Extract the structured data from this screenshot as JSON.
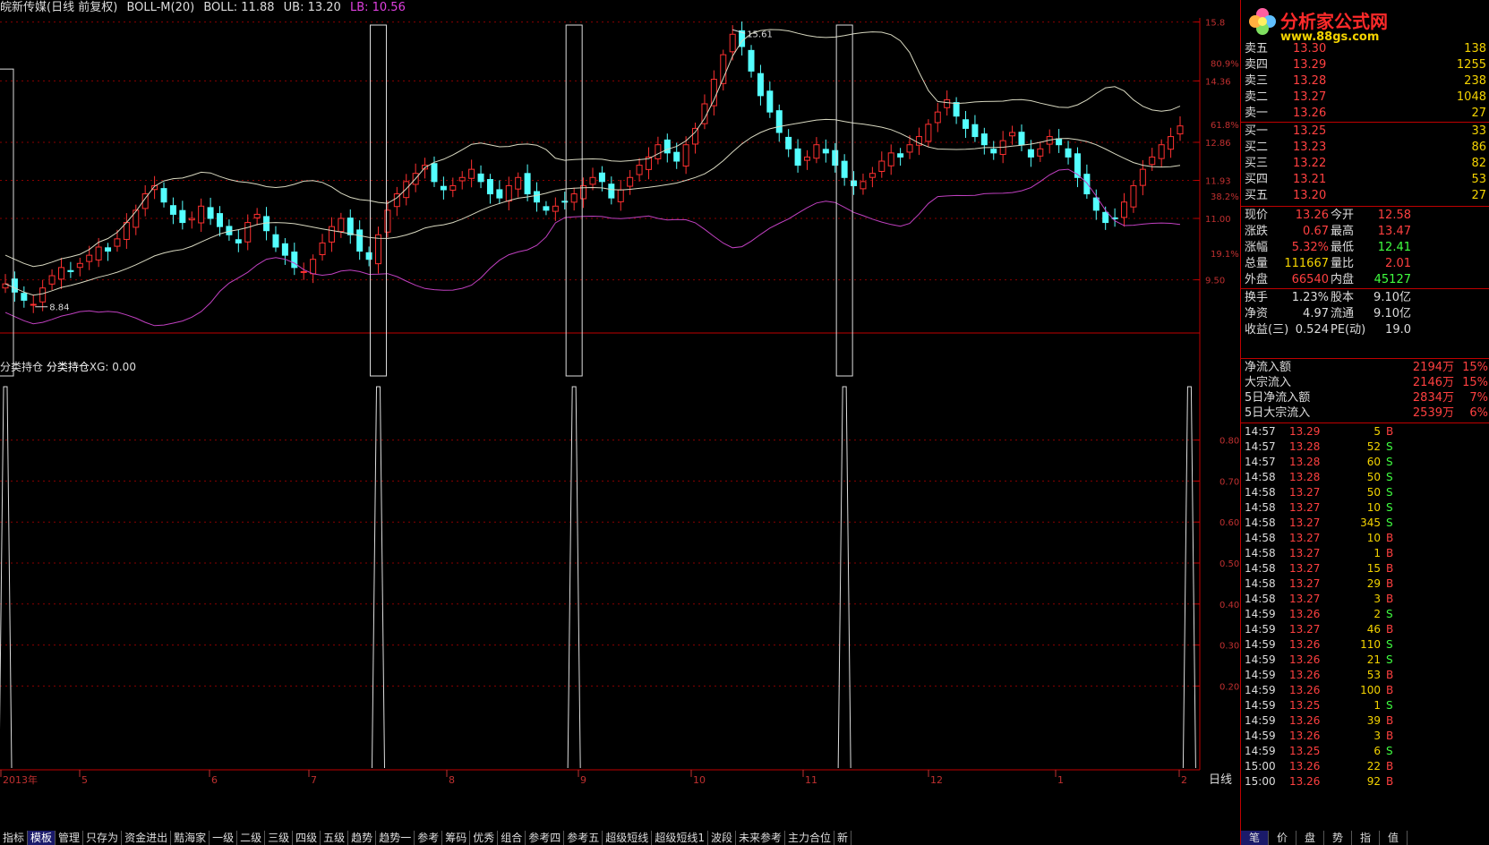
{
  "header": {
    "stock_name": "皖新传媒",
    "period": "(日线 前复权)",
    "indicator": "BOLL-M(20)",
    "boll": "BOLL: 11.88",
    "ub": "UB: 13.20",
    "lb": "LB: 10.56"
  },
  "sub_header": {
    "name1": "分类持仓",
    "name2": "分类持仓",
    "xg": "XG: 0.00"
  },
  "colors": {
    "up": "#ff3030",
    "down": "#54ffff",
    "mid": "#d8d8c0",
    "upper": "#d8d8c0",
    "lower": "#c040c0",
    "grid": "#8a0000",
    "axis": "#c00000"
  },
  "price_axis": {
    "ticks": [
      "15.8",
      "14.36",
      "12.86",
      "11.93",
      "11.00",
      "9.50"
    ],
    "pct": [
      "80.9%",
      "61.8%",
      "38.2%",
      "19.1%"
    ]
  },
  "indicator_axis": {
    "ticks": [
      "0.80",
      "0.70",
      "0.60",
      "0.50",
      "0.40",
      "0.30",
      "0.20"
    ]
  },
  "annotations": {
    "high": "15.61",
    "low": "8.84"
  },
  "time_axis": [
    "2013年",
    "5",
    "6",
    "7",
    "8",
    "9",
    "10",
    "11",
    "12",
    "1",
    "2"
  ],
  "chart_data": {
    "type": "candlestick",
    "title": "皖新传媒 (日线 前复权) BOLL-M(20)",
    "ylim": [
      8.2,
      15.9
    ],
    "markers": {
      "high": 15.61,
      "low": 8.84
    },
    "signal_ylim": [
      0,
      1
    ],
    "signal_values_at_bars": [
      1,
      1,
      1,
      1,
      1,
      1
    ],
    "bollinger_last": {
      "mid": 11.88,
      "upper": 13.2,
      "lower": 10.56
    },
    "close_series": [
      9.4,
      9.2,
      9.0,
      8.9,
      9.3,
      9.6,
      9.8,
      9.7,
      9.9,
      10.1,
      10.3,
      10.2,
      10.5,
      10.9,
      11.2,
      11.6,
      11.8,
      11.4,
      11.1,
      10.9,
      11.0,
      11.3,
      11.0,
      10.8,
      10.6,
      10.4,
      10.9,
      11.1,
      10.7,
      10.3,
      10.1,
      9.8,
      9.7,
      10.0,
      10.4,
      10.8,
      11.0,
      10.6,
      10.2,
      10.0,
      10.6,
      11.2,
      11.6,
      11.9,
      12.1,
      12.3,
      11.9,
      11.7,
      11.8,
      12.0,
      12.2,
      11.9,
      11.6,
      11.5,
      11.8,
      12.0,
      11.6,
      11.4,
      11.2,
      11.3,
      11.4,
      11.6,
      11.8,
      12.0,
      11.9,
      11.5,
      11.7,
      12.0,
      12.3,
      12.5,
      12.8,
      12.6,
      12.4,
      12.8,
      13.2,
      13.8,
      14.4,
      15.0,
      15.5,
      15.2,
      14.6,
      14.0,
      13.6,
      13.1,
      12.7,
      12.3,
      12.5,
      12.8,
      12.6,
      12.3,
      12.0,
      11.8,
      11.9,
      12.1,
      12.4,
      12.6,
      12.5,
      12.8,
      13.0,
      13.3,
      13.6,
      13.9,
      13.5,
      13.2,
      13.0,
      12.8,
      12.6,
      12.9,
      13.1,
      12.8,
      12.5,
      12.7,
      13.0,
      12.8,
      12.5,
      12.0,
      11.6,
      11.2,
      10.9,
      11.0,
      11.4,
      11.8,
      12.2,
      12.5,
      12.8,
      13.0,
      13.26
    ],
    "signal_bars_x_index": [
      0,
      40,
      61,
      90,
      127
    ]
  },
  "quote": {
    "asks": [
      {
        "label": "卖五",
        "price": "13.30",
        "vol": "138"
      },
      {
        "label": "卖四",
        "price": "13.29",
        "vol": "1255"
      },
      {
        "label": "卖三",
        "price": "13.28",
        "vol": "238"
      },
      {
        "label": "卖二",
        "price": "13.27",
        "vol": "1048"
      },
      {
        "label": "卖一",
        "price": "13.26",
        "vol": "27"
      }
    ],
    "bids": [
      {
        "label": "买一",
        "price": "13.25",
        "vol": "33"
      },
      {
        "label": "买二",
        "price": "13.23",
        "vol": "86"
      },
      {
        "label": "买三",
        "price": "13.22",
        "vol": "82"
      },
      {
        "label": "买四",
        "price": "13.21",
        "vol": "53"
      },
      {
        "label": "买五",
        "price": "13.20",
        "vol": "27"
      }
    ]
  },
  "stats": [
    {
      "l1": "现价",
      "v1": "13.26",
      "c1": "#ff4040",
      "l2": "今开",
      "v2": "12.58",
      "c2": "#ff4040"
    },
    {
      "l1": "涨跌",
      "v1": "0.67",
      "c1": "#ff4040",
      "l2": "最高",
      "v2": "13.47",
      "c2": "#ff4040"
    },
    {
      "l1": "涨幅",
      "v1": "5.32%",
      "c1": "#ff4040",
      "l2": "最低",
      "v2": "12.41",
      "c2": "#40ff40"
    },
    {
      "l1": "总量",
      "v1": "111667",
      "c1": "#f5d400",
      "l2": "量比",
      "v2": "2.01",
      "c2": "#ff4040"
    },
    {
      "l1": "外盘",
      "v1": "66540",
      "c1": "#ff4040",
      "l2": "内盘",
      "v2": "45127",
      "c2": "#40ff40"
    },
    {
      "l1": "换手",
      "v1": "1.23%",
      "c1": "#ddd",
      "l2": "股本",
      "v2": "9.10亿",
      "c2": "#ddd"
    },
    {
      "l1": "净资",
      "v1": "4.97",
      "c1": "#ddd",
      "l2": "流通",
      "v2": "9.10亿",
      "c2": "#ddd"
    },
    {
      "l1": "收益(三)",
      "v1": "0.524",
      "c1": "#ddd",
      "l2": "PE(动)",
      "v2": "19.0",
      "c2": "#ddd"
    }
  ],
  "funds": [
    {
      "label": "净流入额",
      "value": "2194万",
      "pct": "15%"
    },
    {
      "label": "大宗流入",
      "value": "2146万",
      "pct": "15%"
    },
    {
      "label": "5日净流入额",
      "value": "2834万",
      "pct": "7%"
    },
    {
      "label": "5日大宗流入",
      "value": "2539万",
      "pct": "6%"
    }
  ],
  "ticks": [
    {
      "t": "14:57",
      "p": "13.29",
      "v": "5",
      "s": "B"
    },
    {
      "t": "14:57",
      "p": "13.28",
      "v": "52",
      "s": "S"
    },
    {
      "t": "14:57",
      "p": "13.28",
      "v": "60",
      "s": "S"
    },
    {
      "t": "14:58",
      "p": "13.28",
      "v": "50",
      "s": "S"
    },
    {
      "t": "14:58",
      "p": "13.27",
      "v": "50",
      "s": "S"
    },
    {
      "t": "14:58",
      "p": "13.27",
      "v": "10",
      "s": "S"
    },
    {
      "t": "14:58",
      "p": "13.27",
      "v": "345",
      "s": "S"
    },
    {
      "t": "14:58",
      "p": "13.27",
      "v": "10",
      "s": "B"
    },
    {
      "t": "14:58",
      "p": "13.27",
      "v": "1",
      "s": "B"
    },
    {
      "t": "14:58",
      "p": "13.27",
      "v": "15",
      "s": "B"
    },
    {
      "t": "14:58",
      "p": "13.27",
      "v": "29",
      "s": "B"
    },
    {
      "t": "14:58",
      "p": "13.27",
      "v": "3",
      "s": "B"
    },
    {
      "t": "14:59",
      "p": "13.26",
      "v": "2",
      "s": "S"
    },
    {
      "t": "14:59",
      "p": "13.27",
      "v": "46",
      "s": "B"
    },
    {
      "t": "14:59",
      "p": "13.26",
      "v": "110",
      "s": "S"
    },
    {
      "t": "14:59",
      "p": "13.26",
      "v": "21",
      "s": "S"
    },
    {
      "t": "14:59",
      "p": "13.26",
      "v": "53",
      "s": "B"
    },
    {
      "t": "14:59",
      "p": "13.26",
      "v": "100",
      "s": "B"
    },
    {
      "t": "14:59",
      "p": "13.25",
      "v": "1",
      "s": "S"
    },
    {
      "t": "14:59",
      "p": "13.26",
      "v": "39",
      "s": "B"
    },
    {
      "t": "14:59",
      "p": "13.26",
      "v": "3",
      "s": "B"
    },
    {
      "t": "14:59",
      "p": "13.25",
      "v": "6",
      "s": "S"
    },
    {
      "t": "15:00",
      "p": "13.26",
      "v": "22",
      "s": "B"
    },
    {
      "t": "15:00",
      "p": "13.26",
      "v": "92",
      "s": "B"
    }
  ],
  "logo": {
    "title": "分析家公式网",
    "url": "www.88gs.com"
  },
  "bottom_tabs": [
    "指标",
    "模板",
    "管理",
    "只存为",
    "资金进出",
    "黠海家",
    "一级",
    "二级",
    "三级",
    "四级",
    "五级",
    "趋势",
    "趋势一",
    "参考",
    "筹码",
    "优秀",
    "组合",
    "参考四",
    "参考五",
    "超级短线",
    "超级短线1",
    "波段",
    "未来参考",
    "主力合位",
    "新"
  ],
  "right_tabs": [
    "笔",
    "价",
    "盘",
    "势",
    "指",
    "值"
  ],
  "daily_label": "日线"
}
